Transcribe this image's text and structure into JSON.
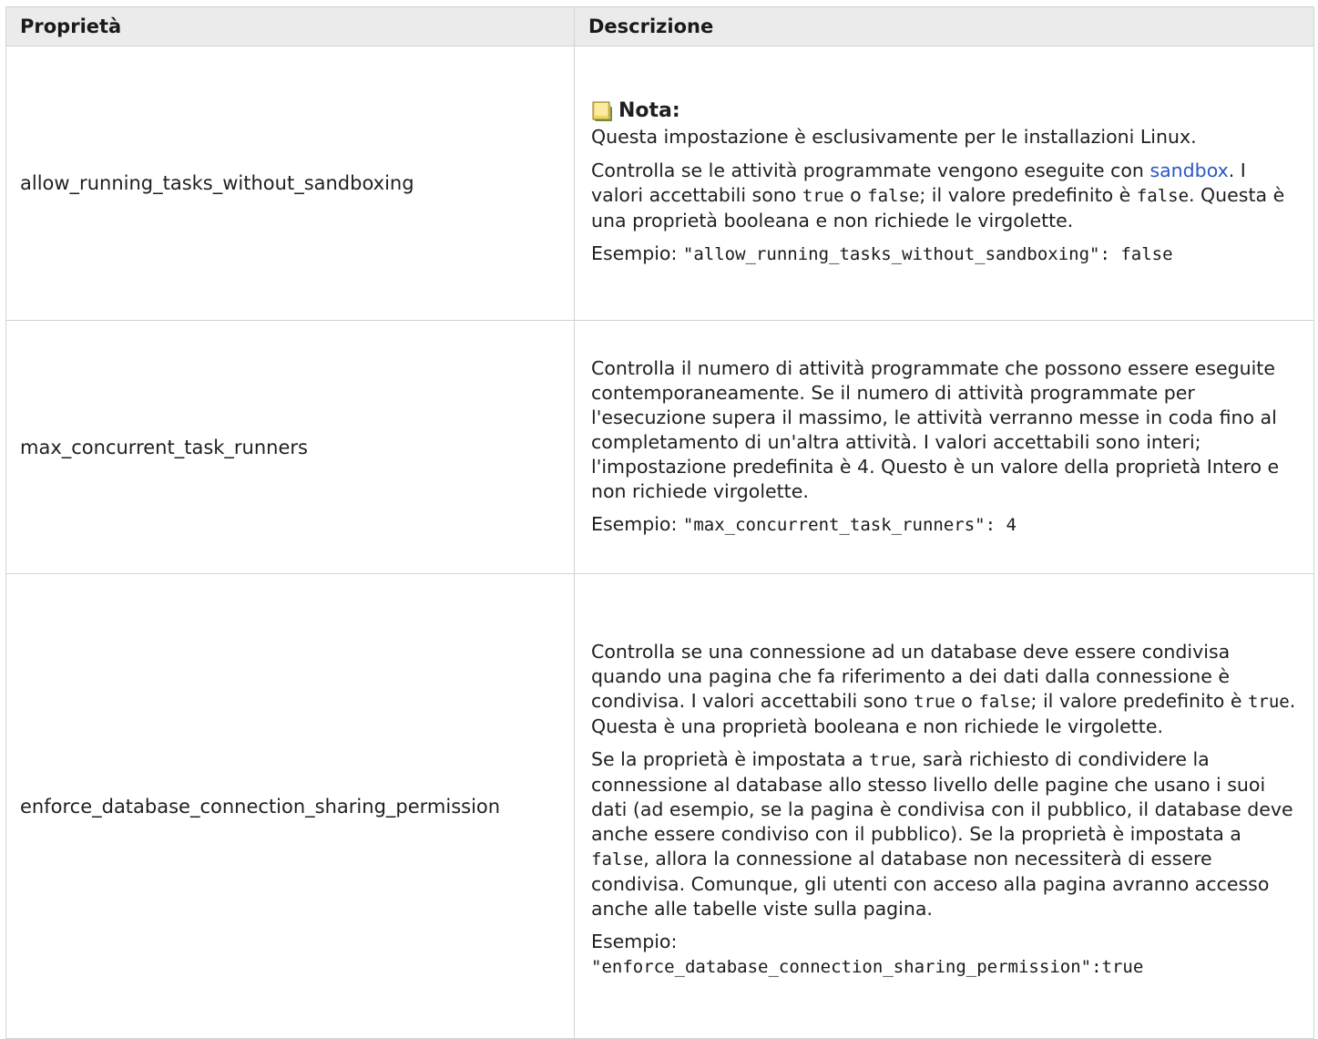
{
  "header": {
    "col_property": "Proprietà",
    "col_description": "Descrizione"
  },
  "rows": [
    {
      "property": "allow_running_tasks_without_sandboxing",
      "note_label": "Nota:",
      "note_text": "Questa impostazione è esclusivamente per le installazioni Linux.",
      "p1_a": "Controlla se le attività programmate vengono eseguite con ",
      "p1_link": "sandbox",
      "p1_b": ". I valori accettabili sono ",
      "p1_code1": "true",
      "p1_c": " o ",
      "p1_code2": "false",
      "p1_d": "; il valore predefinito è ",
      "p1_code3": "false",
      "p1_e": ". Questa è una proprietà booleana e non richiede le virgolette.",
      "example_label": "Esempio: ",
      "example_code": "\"allow_running_tasks_without_sandboxing\": false"
    },
    {
      "property": "max_concurrent_task_runners",
      "p1": "Controlla il numero di attività programmate che possono essere eseguite contemporaneamente. Se il numero di attività programmate per l'esecuzione supera il massimo, le attività verranno messe in coda fino al completamento di un'altra attività. I valori accettabili sono interi; l'impostazione predefinita è 4. Questo è un valore della proprietà Intero e non richiede virgolette.",
      "example_label": "Esempio: ",
      "example_code": "\"max_concurrent_task_runners\": 4"
    },
    {
      "property": "enforce_database_connection_sharing_permission",
      "p1_a": "Controlla se una connessione ad un database deve essere condivisa quando una pagina che fa riferimento a dei dati dalla connessione è condivisa. I valori accettabili sono ",
      "p1_code1": "true",
      "p1_b": " o ",
      "p1_code2": "false",
      "p1_c": "; il valore predefinito è ",
      "p1_code3": "true",
      "p1_d": ". Questa è una proprietà booleana e non richiede le virgolette.",
      "p2_a": "Se la proprietà è impostata a ",
      "p2_code1": "true",
      "p2_b": ", sarà richiesto di condividere la connessione al database allo stesso livello delle pagine che usano i suoi dati (ad esempio, se la pagina è condivisa con il pubblico, il database deve anche essere condiviso con il pubblico). Se la proprietà è impostata a ",
      "p2_code2": "false",
      "p2_c": ", allora la connessione al database non necessiterà di essere condivisa. Comunque, gli utenti con acceso alla pagina avranno accesso anche alle tabelle viste sulla pagina.",
      "example_label": "Esempio:",
      "example_code": "\"enforce_database_connection_sharing_permission\":true"
    }
  ],
  "icons": {
    "note": "note-icon"
  },
  "colors": {
    "header_bg": "#ebebeb",
    "border": "#d3d3d3",
    "link": "#2b56c5",
    "note_icon": "#e8c84a"
  }
}
